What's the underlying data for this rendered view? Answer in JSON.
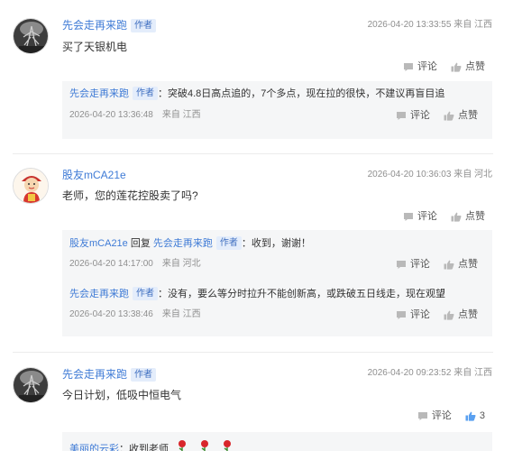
{
  "comments": [
    {
      "author": "先会走再来跑",
      "badge": "作者",
      "timestamp": "2026-04-20 13:33:55",
      "location": "来自 江西",
      "content": "买了天银机电",
      "comment_label": "评论",
      "like_label": "点赞",
      "replies": [
        {
          "author": "先会走再来跑",
          "badge": "作者",
          "content": "：突破4.8日高点追的，7个多点，现在拉的很快，不建议再盲目追",
          "time": "2026-04-20 13:36:48",
          "location": "来自 江西",
          "comment_label": "评论",
          "like_label": "点赞"
        }
      ]
    },
    {
      "author": "股友mCA21e",
      "timestamp": "2026-04-20 10:36:03",
      "location": "来自 河北",
      "content": "老师，您的莲花控股卖了吗?",
      "comment_label": "评论",
      "like_label": "点赞",
      "replies": [
        {
          "author": "股友mCA21e",
          "reply_word": "回复",
          "target": "先会走再来跑",
          "badge": "作者",
          "content": "：收到，谢谢！",
          "time": "2026-04-20 14:17:00",
          "location": "来自 河北",
          "comment_label": "评论",
          "like_label": "点赞"
        },
        {
          "author": "先会走再来跑",
          "badge": "作者",
          "content": "：没有，要么等分时拉升不能创新高，或跌破五日线走，现在观望",
          "time": "2026-04-20 13:38:46",
          "location": "来自 江西",
          "comment_label": "评论",
          "like_label": "点赞"
        }
      ]
    },
    {
      "author": "先会走再来跑",
      "badge": "作者",
      "timestamp": "2026-04-20 09:23:52",
      "location": "来自 江西",
      "content": "今日计划，低吸中恒电气",
      "comment_label": "评论",
      "like_count": "3",
      "replies": [
        {
          "author": "美丽的云彩",
          "content": "：收到老师"
        }
      ]
    }
  ],
  "colors": {
    "link": "#3f7bd6",
    "badge_bg": "#e4edfb",
    "reply_bg": "#f5f6f7",
    "meta": "#8f8f8f",
    "like_active": "#5aa0f0",
    "rose": "#d8262b"
  },
  "icons": {
    "comment": "comment-icon",
    "like": "thumbs-up-icon",
    "rose": "rose-emoji"
  }
}
